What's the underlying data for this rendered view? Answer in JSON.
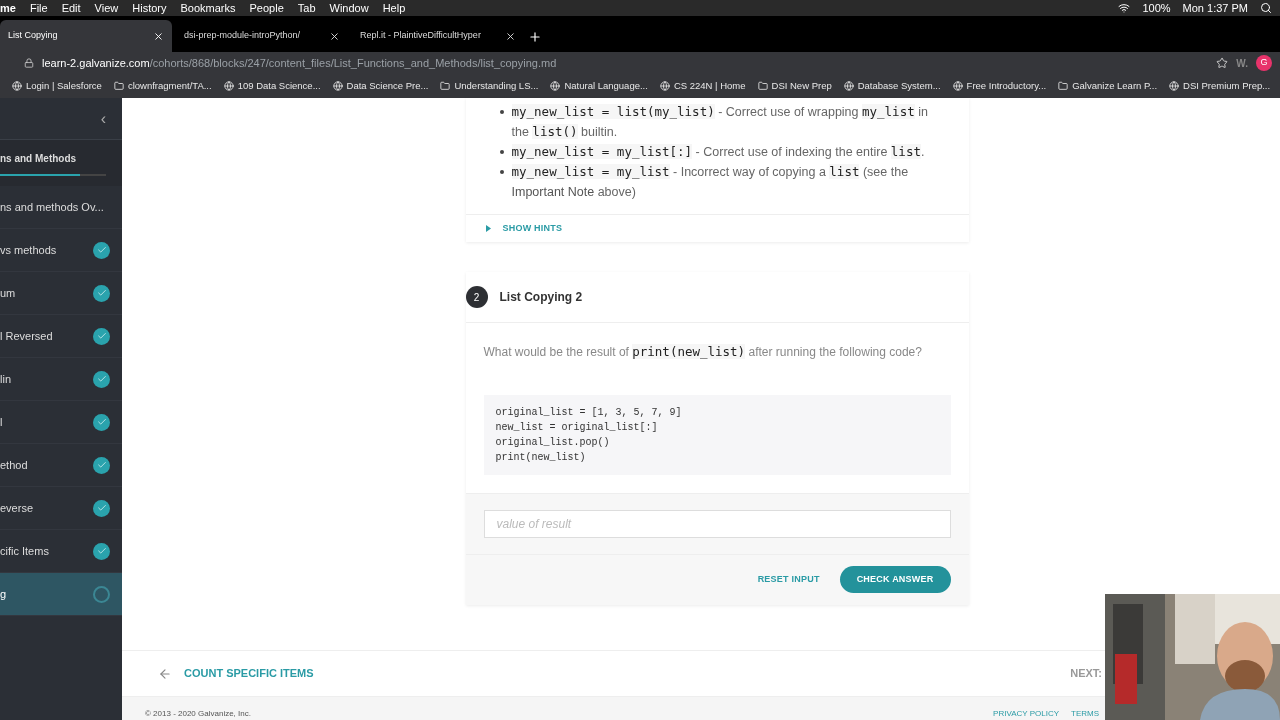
{
  "menubar": {
    "app": "me",
    "items": [
      "File",
      "Edit",
      "View",
      "History",
      "Bookmarks",
      "People",
      "Tab",
      "Window",
      "Help"
    ],
    "battery": "100%",
    "clock": "Mon 1:37 PM"
  },
  "tabs": [
    {
      "label": "List Copying",
      "selected": true
    },
    {
      "label": "dsi-prep-module-introPython/",
      "selected": false
    },
    {
      "label": "Repl.it - PlaintiveDifficultHyper",
      "selected": false
    }
  ],
  "address": {
    "host": "learn-2.galvanize.com",
    "path": "/cohorts/868/blocks/247/content_files/List_Functions_and_Methods/list_copying.md",
    "profile": "G",
    "extension": "W."
  },
  "bookmarks": [
    "Login | Salesforce",
    "clownfragment/TA...",
    "109 Data Science...",
    "Data Science Pre...",
    "Understanding LS...",
    "Natural Language...",
    "CS 224N | Home",
    "DSI New Prep",
    "Database System...",
    "Free Introductory...",
    "Galvanize Learn P...",
    "DSI Premium Prep..."
  ],
  "sidebar": {
    "collapse": "‹",
    "section": "ns and Methods",
    "progress": {
      "level": 0.75
    },
    "items": [
      {
        "label": "ns and methods Ov...",
        "completed": false,
        "selected": false
      },
      {
        "label": "vs methods",
        "completed": true,
        "selected": false
      },
      {
        "label": "um",
        "completed": true,
        "selected": false
      },
      {
        "label": "l Reversed",
        "completed": true,
        "selected": false
      },
      {
        "label": "lin",
        "completed": true,
        "selected": false
      },
      {
        "label": "l",
        "completed": true,
        "selected": false
      },
      {
        "label": "ethod",
        "completed": true,
        "selected": false
      },
      {
        "label": "everse",
        "completed": true,
        "selected": false
      },
      {
        "label": "cific Items",
        "completed": true,
        "selected": false
      },
      {
        "label": "g",
        "completed": false,
        "selected": true
      }
    ]
  },
  "answers_card": {
    "bullets": [
      [
        {
          "kind": "code",
          "text": "my_new_list = list(my_list)"
        },
        {
          "kind": "text",
          "text": " - Correct use of wrapping "
        },
        {
          "kind": "code",
          "text": "my_list"
        },
        {
          "kind": "text",
          "text": " in the "
        },
        {
          "kind": "code",
          "text": "list()"
        },
        {
          "kind": "text",
          "text": " builtin."
        }
      ],
      [
        {
          "kind": "code",
          "text": "my_new_list = my_list[:]"
        },
        {
          "kind": "text",
          "text": " - Correct use of indexing the entire "
        },
        {
          "kind": "code",
          "text": "list"
        },
        {
          "kind": "text",
          "text": "."
        }
      ],
      [
        {
          "kind": "code",
          "text": "my_new_list = my_list"
        },
        {
          "kind": "text",
          "text": " - Incorrect way of copying a "
        },
        {
          "kind": "code",
          "text": "list"
        },
        {
          "kind": "text",
          "text": " (see the "
        },
        {
          "kind": "strong",
          "text": "Important Note"
        },
        {
          "kind": "text",
          "text": " above)"
        }
      ]
    ],
    "hints": "SHOW HINTS"
  },
  "question": {
    "number": "2",
    "title": "List Copying 2",
    "prompt": [
      {
        "kind": "text",
        "text": "What would be the result of "
      },
      {
        "kind": "code",
        "text": "print(new_list)"
      },
      {
        "kind": "text",
        "text": " after running the following code?"
      }
    ],
    "code": [
      "original_list = [1, 3, 5, 7, 9]",
      "new_list = original_list[:]",
      "original_list.pop()",
      "print(new_list)"
    ],
    "answer": {
      "placeholder": "value of result"
    },
    "reset": "RESET INPUT",
    "check": "CHECK ANSWER"
  },
  "nav": {
    "previous": "COUNT SPECIFIC ITEMS",
    "next": "NEXT:"
  },
  "footer": {
    "copyright": "© 2013 - 2020 Galvanize, Inc.",
    "links": [
      "PRIVACY POLICY",
      "TERMS"
    ]
  }
}
